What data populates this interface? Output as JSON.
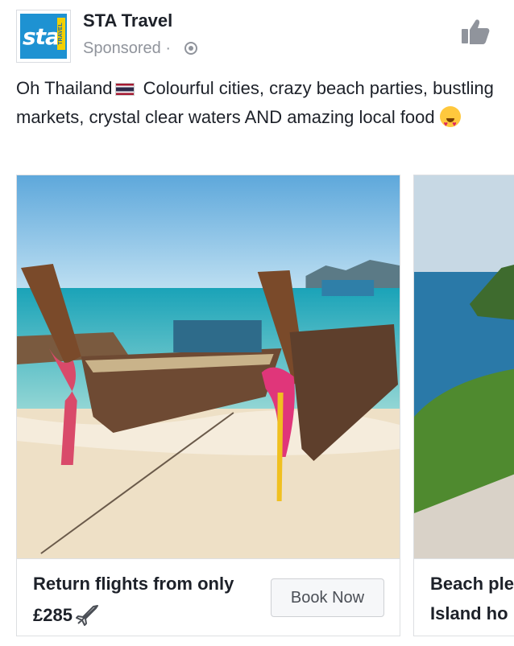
{
  "post": {
    "page_name": "STA Travel",
    "sponsored": "Sponsored",
    "separator": "·",
    "logo_text": "sta",
    "logo_badge": "TRAVEL",
    "text_before_flag": "Oh Thailand",
    "text_after_flag": "Colourful cities, crazy beach parties, bustling markets, crystal clear waters AND amazing local food",
    "icons": {
      "logo": "sta-travel-logo",
      "privacy": "globe-icon",
      "like": "thumbs-up-icon",
      "flag": "thailand-flag-emoji",
      "emoji": "heart-eyes-emoji",
      "plane": "airplane-icon"
    }
  },
  "carousel": {
    "cards": [
      {
        "title": "Return flights from only",
        "price": "£285",
        "button": "Book Now",
        "image": "longtail-boats-on-beach"
      },
      {
        "title": "Beach ple",
        "subtitle": "Island ho",
        "image": "island-coast-view"
      }
    ]
  },
  "colors": {
    "text": "#1d2129",
    "muted": "#90949c",
    "border": "#dddfe2",
    "sta_blue": "#1e92d2"
  }
}
